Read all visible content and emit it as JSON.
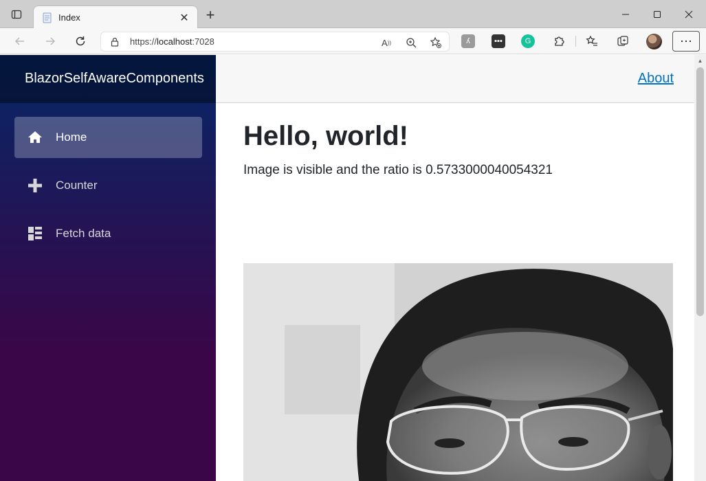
{
  "browser": {
    "tab_title": "Index",
    "url_scheme": "https://",
    "url_host": "localhost",
    "url_port": ":7028"
  },
  "app": {
    "brand": "BlazorSelfAwareComponents",
    "about_link": "About"
  },
  "nav": {
    "items": [
      {
        "label": "Home",
        "icon": "home-icon",
        "active": true
      },
      {
        "label": "Counter",
        "icon": "plus-icon",
        "active": false
      },
      {
        "label": "Fetch data",
        "icon": "list-icon",
        "active": false
      }
    ]
  },
  "main": {
    "heading": "Hello, world!",
    "status_text": "Image is visible and the ratio is 0.5733000040054321"
  },
  "colors": {
    "sidebar_top": "#052767",
    "sidebar_bottom": "#3a0647",
    "link": "#0071c1"
  }
}
